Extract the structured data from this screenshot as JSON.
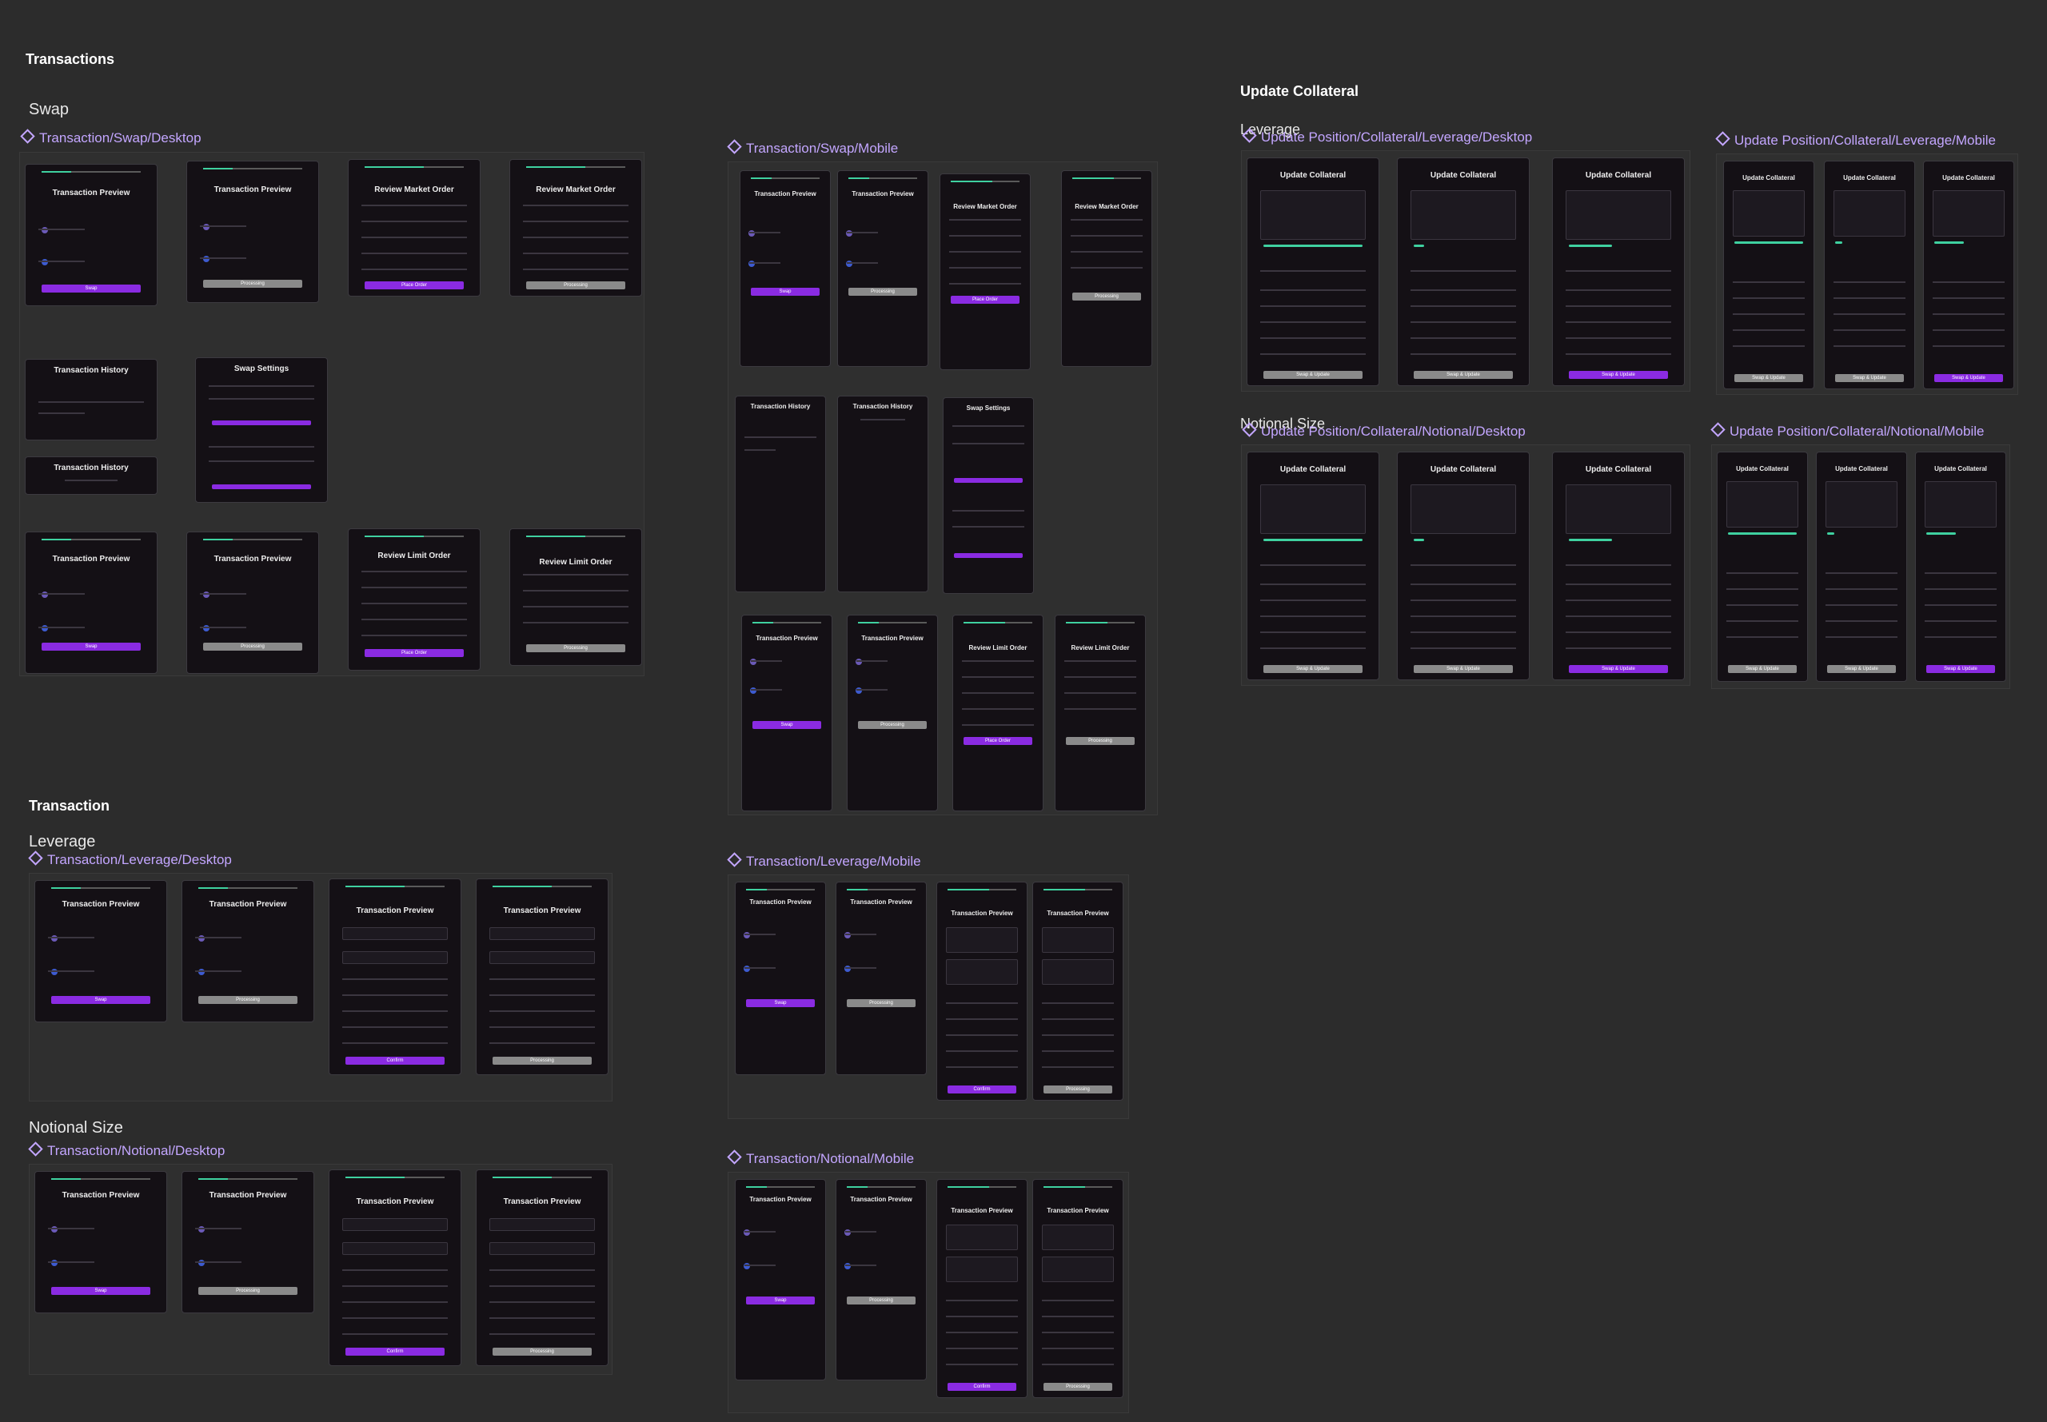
{
  "sections": {
    "transactions": "Transactions",
    "swap": "Swap",
    "transaction": "Transaction",
    "leverage": "Leverage",
    "notional_size": "Notional Size",
    "update_collateral": "Update Collateral",
    "uc_leverage": "Leverage",
    "uc_notional": "Notional Size"
  },
  "components": {
    "swap_desktop": "Transaction/Swap/Desktop",
    "swap_mobile": "Transaction/Swap/Mobile",
    "leverage_desktop": "Transaction/Leverage/Desktop",
    "leverage_mobile": "Transaction/Leverage/Mobile",
    "notional_desktop": "Transaction/Notional/Desktop",
    "notional_mobile": "Transaction/Notional/Mobile",
    "uc_lev_desktop": "Update Position/Collateral/Leverage/Desktop",
    "uc_lev_mobile": "Update Position/Collateral/Leverage/Mobile",
    "uc_not_desktop": "Update Position/Collateral/Notional/Desktop",
    "uc_not_mobile": "Update Position/Collateral/Notional/Mobile"
  },
  "card_titles": {
    "preview": "Transaction Preview",
    "market": "Review Market Order",
    "limit": "Review Limit Order",
    "history": "Transaction History",
    "settings": "Swap Settings",
    "collateral": "Update Collateral"
  },
  "buttons": {
    "swap": "Swap",
    "confirm": "Confirm",
    "update": "Swap & Update",
    "processing": "Processing",
    "place": "Place Order"
  },
  "accent": {
    "primary": "#8a2be2",
    "success": "#3fd1a0",
    "label": "#c3a6ff",
    "card_bg": "#141015"
  }
}
